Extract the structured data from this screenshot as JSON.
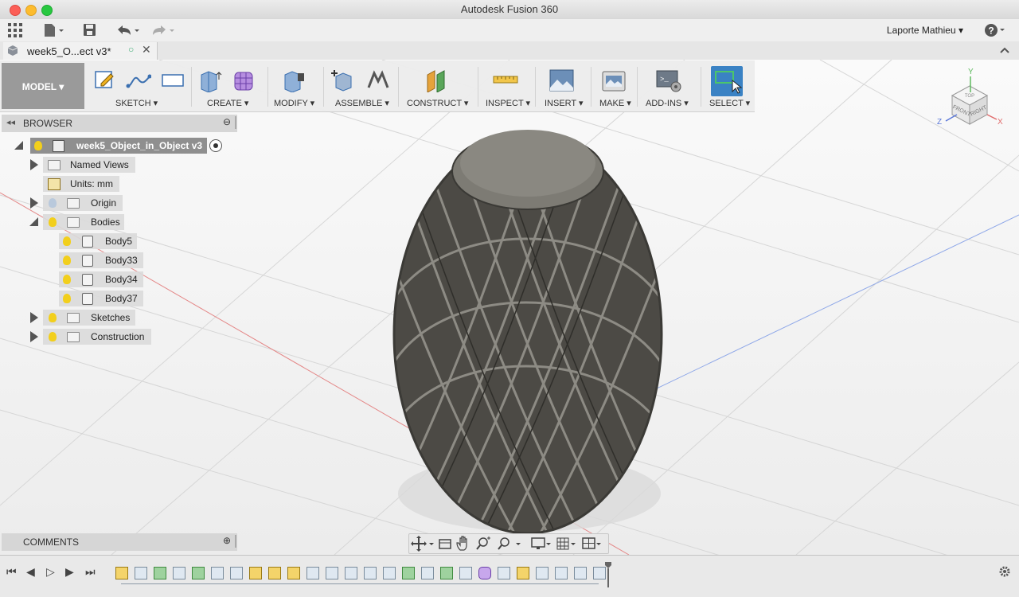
{
  "window": {
    "title": "Autodesk Fusion 360"
  },
  "user": {
    "name": "Laporte Mathieu"
  },
  "document_tab": {
    "label": "week5_O...ect v3*"
  },
  "toolbar": {
    "workspace": "MODEL",
    "groups": [
      "SKETCH",
      "CREATE",
      "MODIFY",
      "ASSEMBLE",
      "CONSTRUCT",
      "INSPECT",
      "INSERT",
      "MAKE",
      "ADD-INS",
      "SELECT"
    ]
  },
  "browser": {
    "title": "BROWSER",
    "root": "week5_Object_in_Object v3",
    "items": {
      "named_views": "Named Views",
      "units": "Units: mm",
      "origin": "Origin",
      "bodies": "Bodies",
      "sketches": "Sketches",
      "construction": "Construction"
    },
    "bodies": [
      "Body5",
      "Body33",
      "Body34",
      "Body37"
    ]
  },
  "comments": {
    "title": "COMMENTS"
  },
  "viewcube": {
    "top": "TOP",
    "front": "FRONT",
    "right": "RIGHT",
    "axis_x": "X",
    "axis_y": "Y",
    "axis_z": "Z"
  },
  "colors": {
    "accent": "#3a82c4",
    "bulb": "#f2cf1c",
    "model": "#5b5952"
  }
}
